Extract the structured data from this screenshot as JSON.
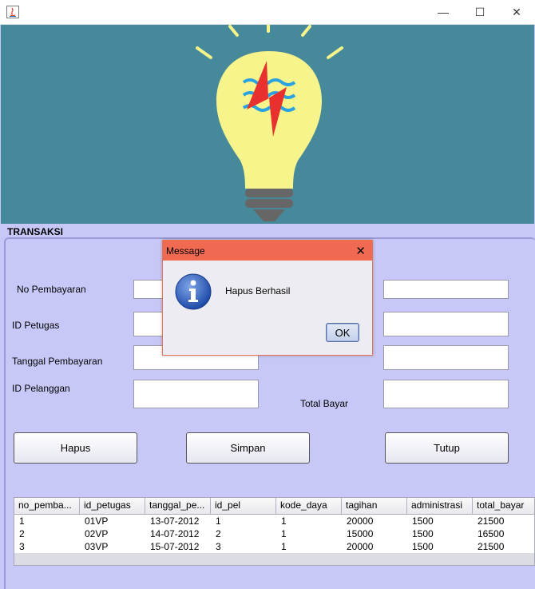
{
  "window": {
    "minimize_glyph": "—",
    "maximize_glyph": "☐",
    "close_glyph": "✕"
  },
  "section_title": "TRANSAKSI",
  "form": {
    "no_pembayaran_label": "No Pembayaran",
    "id_petugas_label": "ID Petugas",
    "tanggal_label": "Tanggal Pembayaran",
    "id_pelanggan_label": "ID Pelanggan",
    "total_bayar_label": "Total Bayar"
  },
  "buttons": {
    "hapus": "Hapus",
    "simpan": "Simpan",
    "tutup": "Tutup"
  },
  "table": {
    "headers": [
      "no_pemba...",
      "id_petugas",
      "tanggal_pe...",
      "id_pel",
      "kode_daya",
      "tagihan",
      "administrasi",
      "total_bayar"
    ],
    "rows": [
      [
        "1",
        "01VP",
        "13-07-2012",
        "1",
        "1",
        "20000",
        "1500",
        "21500"
      ],
      [
        "2",
        "02VP",
        "14-07-2012",
        "2",
        "1",
        "15000",
        "1500",
        "16500"
      ],
      [
        "3",
        "03VP",
        "15-07-2012",
        "3",
        "1",
        "20000",
        "1500",
        "21500"
      ]
    ]
  },
  "dialog": {
    "title": "Message",
    "message": "Hapus Berhasil",
    "ok_label": "OK",
    "close_glyph": "✕"
  },
  "colors": {
    "banner": "#45899a",
    "background": "#c8c8f8",
    "dialog_title": "#f06a52",
    "bulb": "#f6f48a"
  }
}
